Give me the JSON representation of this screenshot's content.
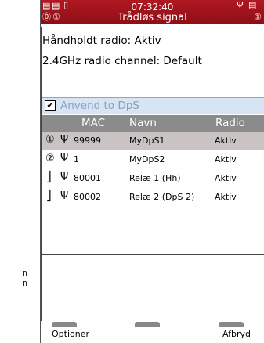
{
  "status_bar": {
    "time": "07:32:40",
    "title": "Trådløs signal",
    "icons_left": [
      "signal-strength-icon",
      "signal-strength-icon",
      "battery-icon",
      "headset-1-icon",
      "headset-1-icon"
    ],
    "icons_right": [
      "antenna-icon",
      "signal-strength-icon",
      "headset-1-icon"
    ]
  },
  "info": {
    "handheld_radio": "Håndholdt radio: Aktiv",
    "radio_channel": "2.4GHz radio channel: Default"
  },
  "checkbox": {
    "label": "Anvend to DpS",
    "checked": true,
    "mark": "✔"
  },
  "list": {
    "headers": {
      "mac": "MAC",
      "name": "Navn",
      "radio": "Radio"
    },
    "rows": [
      {
        "device": "①",
        "antenna": "Ψ",
        "mac": "99999",
        "name": "MyDpS1",
        "radio": "Aktiv"
      },
      {
        "device": "②",
        "antenna": "Ψ",
        "mac": "1",
        "name": "MyDpS2",
        "radio": "Aktiv"
      },
      {
        "device": "⎦",
        "antenna": "Ψ",
        "mac": "80001",
        "name": "Relæ 1 (Hh)",
        "radio": "Aktiv"
      },
      {
        "device": "⎦",
        "antenna": "Ψ",
        "mac": "80002",
        "name": "Relæ 2 (DpS 2)",
        "radio": "Aktiv"
      }
    ]
  },
  "softkeys": {
    "left": "Optioner",
    "right": "Afbryd"
  },
  "gutter_text": [
    "n",
    "n"
  ],
  "colors": {
    "statusbar": "#a0141c",
    "header": "#8b8b8b",
    "selected": "#c9c3c3",
    "checkbar": "#d7e4f4"
  }
}
